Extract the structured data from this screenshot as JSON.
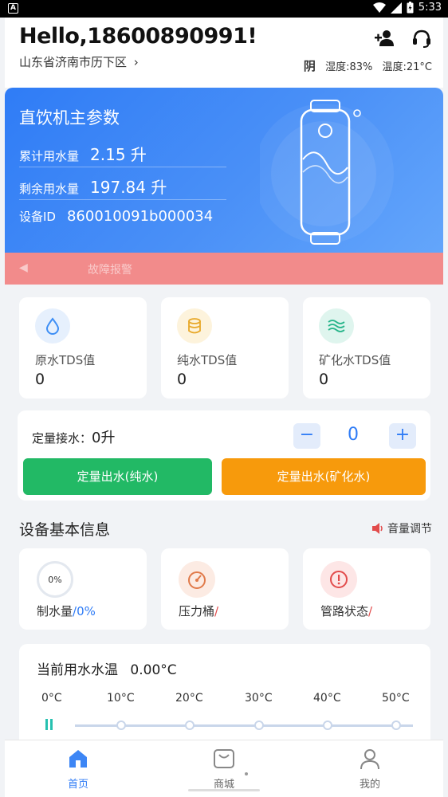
{
  "status_bar": {
    "time": "5:33",
    "left_icon_letter": "A"
  },
  "header": {
    "greeting": "Hello,18600890991!",
    "location": "山东省济南市历下区",
    "weather": {
      "condition": "阴",
      "humidity": "湿度:83%",
      "temperature": "温度:21°C"
    },
    "icons": [
      "add-user-icon",
      "headset-icon"
    ]
  },
  "device_card": {
    "title": "直饮机主参数",
    "cumulative_label": "累计用水量",
    "cumulative_value": "2.15 升",
    "remaining_label": "剩余用水量",
    "remaining_value": "197.84 升",
    "device_id_label": "设备ID",
    "device_id_value": "860010091b000034",
    "alert_text": "故障报警"
  },
  "tds": [
    {
      "label": "原水TDS值",
      "value": "0",
      "icon": "water-drop-icon",
      "color": "#3d8ef5"
    },
    {
      "label": "纯水TDS值",
      "value": "0",
      "icon": "cylinder-icon",
      "color": "#e8a92b"
    },
    {
      "label": "矿化水TDS值",
      "value": "0",
      "icon": "waves-icon",
      "color": "#27b58a"
    }
  ],
  "quantity": {
    "label": "定量接水：",
    "amount": "0升",
    "count": "0",
    "minus": "−",
    "plus": "+",
    "pure_button": "定量出水(纯水)",
    "mineral_button": "定量出水(矿化水)"
  },
  "basic_info": {
    "title": "设备基本信息",
    "volume_label": "音量调节",
    "items": [
      {
        "label": "制水量",
        "value": "/0%",
        "gauge_text": "0%"
      },
      {
        "label": "压力桶",
        "value": "/"
      },
      {
        "label": "管路状态",
        "value": "/"
      }
    ]
  },
  "temperature": {
    "title": "当前用水水温",
    "value": "0.00°C",
    "ticks": [
      "0°C",
      "10°C",
      "20°C",
      "30°C",
      "40°C",
      "50°C"
    ],
    "current_fraction": 0
  },
  "nav": [
    {
      "label": "首页",
      "icon": "home-icon",
      "active": true
    },
    {
      "label": "商城",
      "icon": "shop-bag-icon",
      "active": false
    },
    {
      "label": "我的",
      "icon": "user-icon",
      "active": false
    }
  ],
  "colors": {
    "accent": "#2f7cf6",
    "green": "#22b965",
    "orange": "#f79a0c",
    "alert": "#f28b8b"
  }
}
